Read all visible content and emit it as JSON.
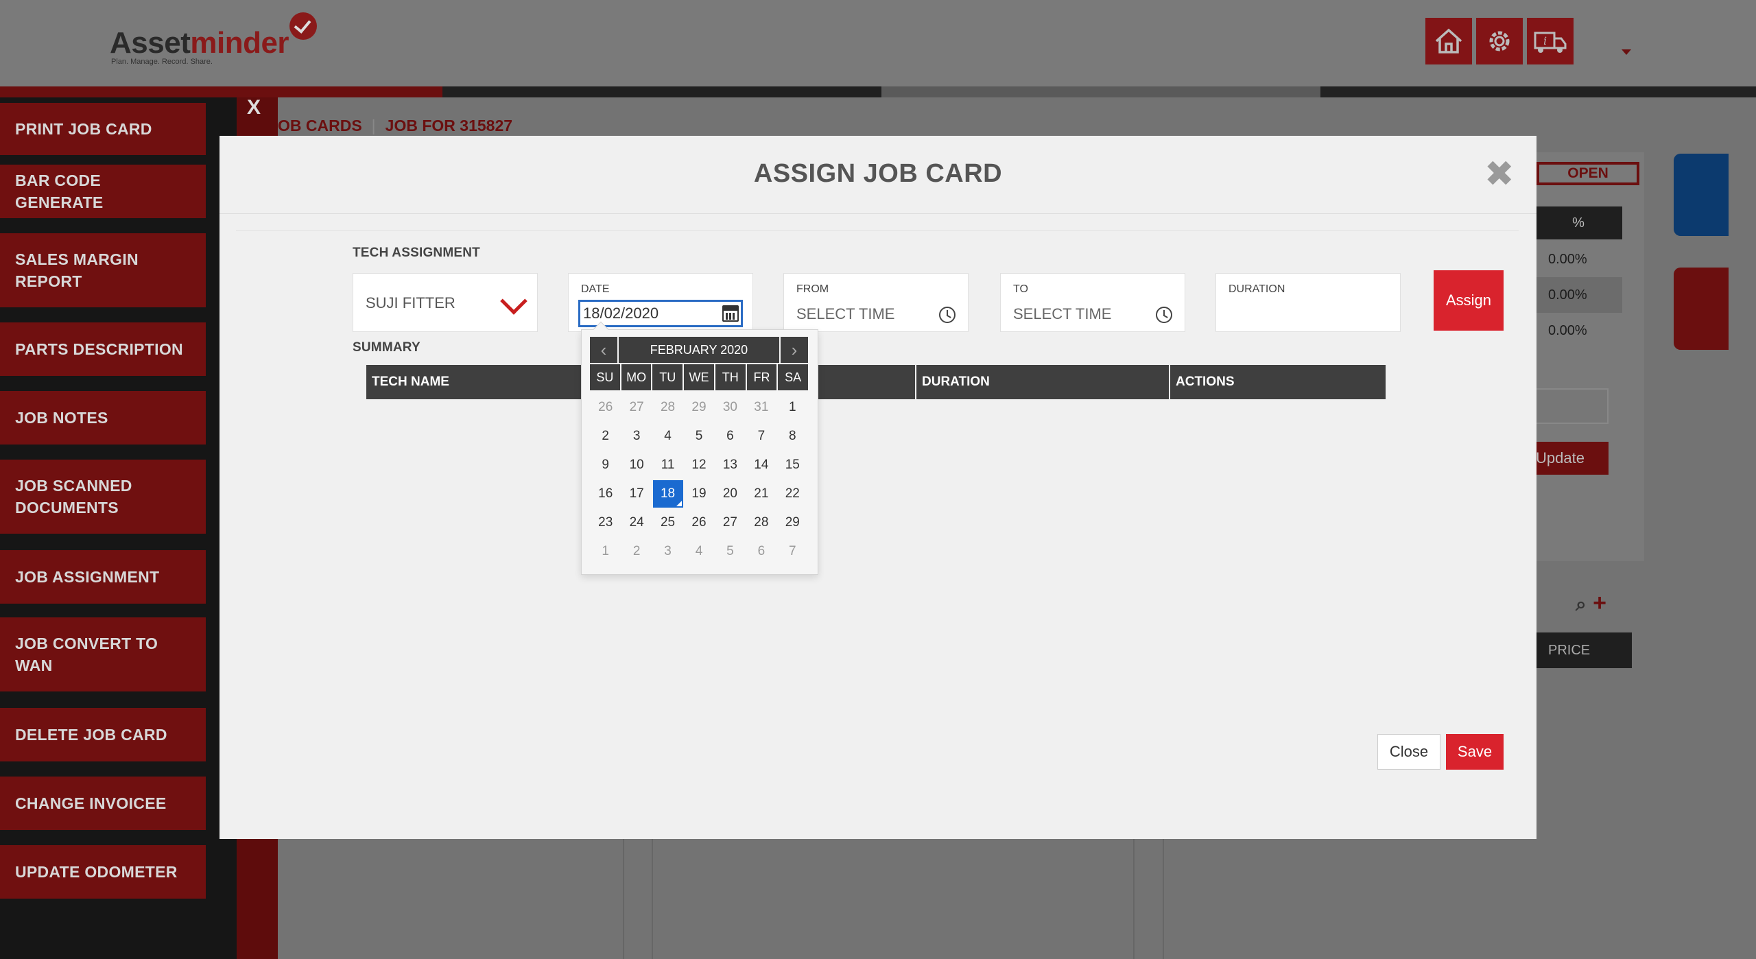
{
  "app": {
    "logo_name_a": "Asset",
    "logo_name_b": "minder",
    "logo_tagline": "Plan. Manage. Record. Share."
  },
  "header_icons": [
    "home-icon",
    "settings-icon",
    "vehicle-info-icon"
  ],
  "sidebar": {
    "close_label": "X",
    "items": [
      {
        "label": "PRINT JOB CARD"
      },
      {
        "label": "BAR CODE GENERATE"
      },
      {
        "label": "SALES MARGIN REPORT"
      },
      {
        "label": "PARTS DESCRIPTION"
      },
      {
        "label": "JOB NOTES"
      },
      {
        "label": "JOB SCANNED DOCUMENTS"
      },
      {
        "label": "JOB ASSIGNMENT"
      },
      {
        "label": "JOB CONVERT TO WAN"
      },
      {
        "label": "DELETE JOB CARD"
      },
      {
        "label": "CHANGE INVOICEE"
      },
      {
        "label": "UPDATE ODOMETER"
      }
    ]
  },
  "breadcrumb": {
    "part1": "OB CARDS",
    "separator": "|",
    "part2": "JOB FOR 315827"
  },
  "background_panel": {
    "status": "OPEN",
    "pct_header": "%",
    "pct_rows": [
      "0.00%",
      "0.00%",
      "0.00%"
    ],
    "update_label": "Update",
    "price_label": "PRICE"
  },
  "modal": {
    "title": "ASSIGN JOB CARD",
    "close_symbol": "✖",
    "tech_section_label": "TECH ASSIGNMENT",
    "tech_value": "SUJI FITTER",
    "date": {
      "label": "DATE",
      "value": "18/02/2020"
    },
    "from": {
      "label": "FROM",
      "placeholder": "SELECT TIME"
    },
    "to": {
      "label": "TO",
      "placeholder": "SELECT TIME"
    },
    "duration": {
      "label": "DURATION",
      "value": ""
    },
    "assign_label": "Assign",
    "summary_label": "SUMMARY",
    "summary_columns": [
      "TECH NAME",
      "",
      "DURATION",
      "ACTIONS"
    ],
    "close_label": "Close",
    "save_label": "Save"
  },
  "datepicker": {
    "title": "FEBRUARY 2020",
    "prev_symbol": "‹",
    "next_symbol": "›",
    "weekdays": [
      "SU",
      "MO",
      "TU",
      "WE",
      "TH",
      "FR",
      "SA"
    ],
    "selected": "18",
    "weeks": [
      [
        {
          "d": "26",
          "o": true
        },
        {
          "d": "27",
          "o": true
        },
        {
          "d": "28",
          "o": true
        },
        {
          "d": "29",
          "o": true
        },
        {
          "d": "30",
          "o": true
        },
        {
          "d": "31",
          "o": true
        },
        {
          "d": "1",
          "o": false
        }
      ],
      [
        {
          "d": "2",
          "o": false
        },
        {
          "d": "3",
          "o": false
        },
        {
          "d": "4",
          "o": false
        },
        {
          "d": "5",
          "o": false
        },
        {
          "d": "6",
          "o": false
        },
        {
          "d": "7",
          "o": false
        },
        {
          "d": "8",
          "o": false
        }
      ],
      [
        {
          "d": "9",
          "o": false
        },
        {
          "d": "10",
          "o": false
        },
        {
          "d": "11",
          "o": false
        },
        {
          "d": "12",
          "o": false
        },
        {
          "d": "13",
          "o": false
        },
        {
          "d": "14",
          "o": false
        },
        {
          "d": "15",
          "o": false
        }
      ],
      [
        {
          "d": "16",
          "o": false
        },
        {
          "d": "17",
          "o": false
        },
        {
          "d": "18",
          "o": false
        },
        {
          "d": "19",
          "o": false
        },
        {
          "d": "20",
          "o": false
        },
        {
          "d": "21",
          "o": false
        },
        {
          "d": "22",
          "o": false
        }
      ],
      [
        {
          "d": "23",
          "o": false
        },
        {
          "d": "24",
          "o": false
        },
        {
          "d": "25",
          "o": false
        },
        {
          "d": "26",
          "o": false
        },
        {
          "d": "27",
          "o": false
        },
        {
          "d": "28",
          "o": false
        },
        {
          "d": "29",
          "o": false
        }
      ],
      [
        {
          "d": "1",
          "o": true
        },
        {
          "d": "2",
          "o": true
        },
        {
          "d": "3",
          "o": true
        },
        {
          "d": "4",
          "o": true
        },
        {
          "d": "5",
          "o": true
        },
        {
          "d": "6",
          "o": true
        },
        {
          "d": "7",
          "o": true
        }
      ]
    ]
  },
  "colors": {
    "brand_red": "#d9232d",
    "dark_header": "#3f3f3f",
    "selected_blue": "#1a6ad0"
  }
}
